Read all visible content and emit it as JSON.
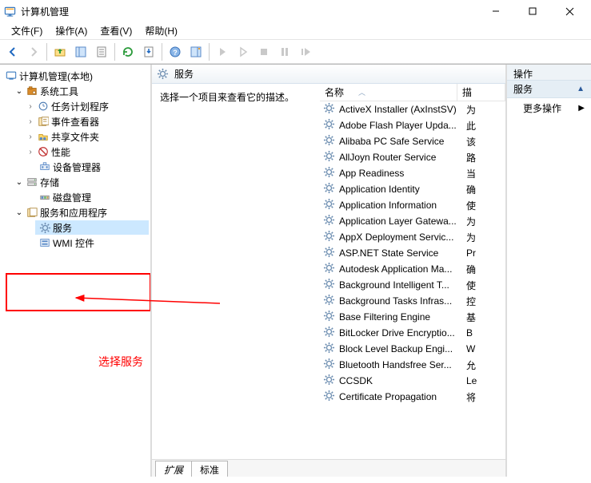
{
  "window": {
    "title": "计算机管理"
  },
  "menu": {
    "file": "文件(F)",
    "action": "操作(A)",
    "view": "查看(V)",
    "help": "帮助(H)"
  },
  "tree": {
    "root": "计算机管理(本地)",
    "system_tools": "系统工具",
    "task_scheduler": "任务计划程序",
    "event_viewer": "事件查看器",
    "shared_folders": "共享文件夹",
    "performance": "性能",
    "device_manager": "设备管理器",
    "storage": "存储",
    "disk_mgmt": "磁盘管理",
    "services_apps": "服务和应用程序",
    "services": "服务",
    "wmi": "WMI 控件"
  },
  "center": {
    "header": "服务",
    "prompt": "选择一个项目来查看它的描述。",
    "col_name": "名称",
    "col_desc": "描",
    "tabs": {
      "extended": "扩展",
      "standard": "标准"
    }
  },
  "services": [
    {
      "name": "ActiveX Installer (AxInstSV)",
      "d": "为"
    },
    {
      "name": "Adobe Flash Player Upda...",
      "d": "此"
    },
    {
      "name": "Alibaba PC Safe Service",
      "d": "该"
    },
    {
      "name": "AllJoyn Router Service",
      "d": "路"
    },
    {
      "name": "App Readiness",
      "d": "当"
    },
    {
      "name": "Application Identity",
      "d": "确"
    },
    {
      "name": "Application Information",
      "d": "使"
    },
    {
      "name": "Application Layer Gatewa...",
      "d": "为"
    },
    {
      "name": "AppX Deployment Servic...",
      "d": "为"
    },
    {
      "name": "ASP.NET State Service",
      "d": "Pr"
    },
    {
      "name": "Autodesk Application Ma...",
      "d": "确"
    },
    {
      "name": "Background Intelligent T...",
      "d": "使"
    },
    {
      "name": "Background Tasks Infras...",
      "d": "控"
    },
    {
      "name": "Base Filtering Engine",
      "d": "基"
    },
    {
      "name": "BitLocker Drive Encryptio...",
      "d": "B"
    },
    {
      "name": "Block Level Backup Engi...",
      "d": "W"
    },
    {
      "name": "Bluetooth Handsfree Ser...",
      "d": "允"
    },
    {
      "name": "CCSDK",
      "d": "Le"
    },
    {
      "name": "Certificate Propagation",
      "d": "将"
    }
  ],
  "actions": {
    "title": "操作",
    "section": "服务",
    "more": "更多操作"
  },
  "annotation": {
    "label": "选择服务"
  }
}
